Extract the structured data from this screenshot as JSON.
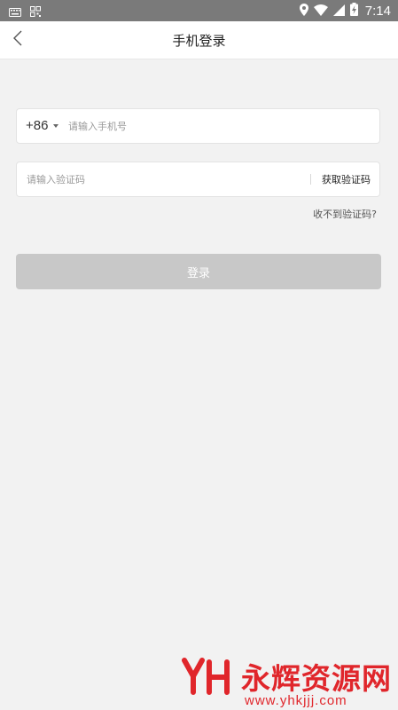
{
  "status_bar": {
    "time": "7:14",
    "icons": [
      "keyboard-icon",
      "qr-scan-icon",
      "location-icon",
      "wifi-icon",
      "signal-icon",
      "battery-charging-icon"
    ]
  },
  "header": {
    "title": "手机登录",
    "back_icon": "chevron-left-icon"
  },
  "form": {
    "country_code": "+86",
    "phone_placeholder": "请输入手机号",
    "code_placeholder": "请输入验证码",
    "get_code_label": "获取验证码",
    "no_code_label": "收不到验证码?",
    "login_label": "登录"
  },
  "watermark": {
    "text": "永辉资源网",
    "url": "www.yhkjjj.com"
  },
  "colors": {
    "background": "#f2f2f2",
    "status_bar": "#7a7a7a",
    "login_button": "#c8c8c8",
    "watermark": "#e0262b"
  }
}
